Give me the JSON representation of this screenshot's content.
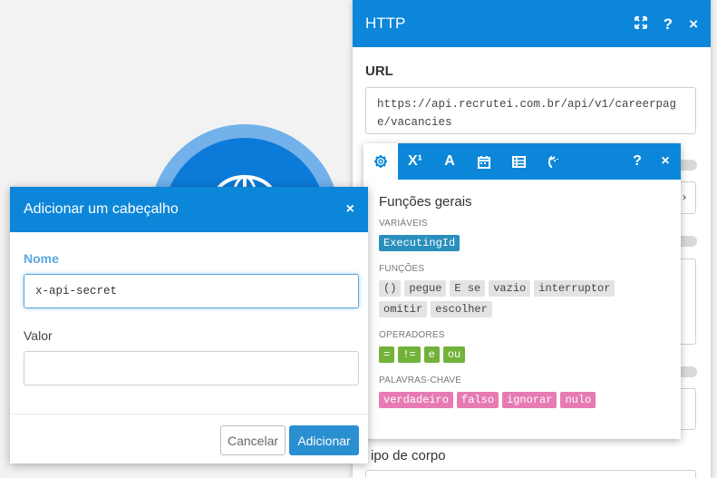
{
  "http_panel": {
    "title": "HTTP",
    "url_label": "URL",
    "url_value": "https://api.recrutei.com.br/api/v1/careerpage/vacancies",
    "body_type_label": "ipo de corpo"
  },
  "functions_popover": {
    "title": "Funções gerais",
    "sections": {
      "variables": {
        "label": "VARIÁVEIS",
        "items": [
          "ExecutingId"
        ]
      },
      "functions": {
        "label": "FUNÇÕES",
        "items": [
          "()",
          "pegue",
          "E se",
          "vazio",
          "interruptor",
          "omitir",
          "escolher"
        ]
      },
      "operators": {
        "label": "OPERADORES",
        "items": [
          "=",
          "!=",
          "e",
          "ou"
        ]
      },
      "keywords": {
        "label": "PALAVRAS-CHAVE",
        "items": [
          "verdadeiro",
          "falso",
          "ignorar",
          "nulo"
        ]
      }
    }
  },
  "dialog": {
    "title": "Adicionar um cabeçalho",
    "name_label": "Nome",
    "name_value": "x-api-secret",
    "value_label": "Valor",
    "value_value": "",
    "cancel_label": "Cancelar",
    "add_label": "Adicionar"
  },
  "icons": {
    "close": "×",
    "help": "?",
    "superscript": "X¹",
    "text": "A"
  },
  "colors": {
    "header_blue": "#0c86d9",
    "variable_chip": "#2a8fbd",
    "operator_chip": "#72b23a",
    "keyword_chip": "#e67bb4",
    "add_button": "#2a8fd0"
  }
}
